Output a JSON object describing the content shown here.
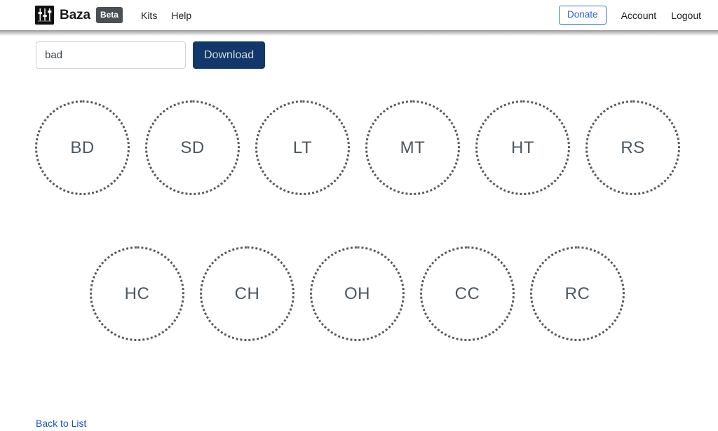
{
  "header": {
    "brand_name": "Baza",
    "beta_badge": "Beta",
    "logo_icon": "mixer-faders-icon",
    "nav_links": [
      {
        "label": "Kits",
        "name": "nav-link-kits"
      },
      {
        "label": "Help",
        "name": "nav-link-help"
      }
    ],
    "donate_label": "Donate",
    "account_label": "Account",
    "logout_label": "Logout",
    "donate_accent_color": "#2f62d8"
  },
  "toolbar": {
    "search_value": "bad",
    "search_placeholder": "Search",
    "download_label": "Download",
    "download_bg_color": "#11376b"
  },
  "pads": {
    "row_1": [
      {
        "label": "BD",
        "name": "pad-bd"
      },
      {
        "label": "SD",
        "name": "pad-sd"
      },
      {
        "label": "LT",
        "name": "pad-lt"
      },
      {
        "label": "MT",
        "name": "pad-mt"
      },
      {
        "label": "HT",
        "name": "pad-ht"
      },
      {
        "label": "RS",
        "name": "pad-rs"
      }
    ],
    "row_2": [
      {
        "label": "HC",
        "name": "pad-hc"
      },
      {
        "label": "CH",
        "name": "pad-ch"
      },
      {
        "label": "OH",
        "name": "pad-oh"
      },
      {
        "label": "CC",
        "name": "pad-cc"
      },
      {
        "label": "RC",
        "name": "pad-rc"
      }
    ],
    "border_color": "#58595b",
    "label_color": "#4c5760"
  },
  "footer": {
    "back_link_label": "Back to List",
    "link_color": "#1454c4"
  }
}
